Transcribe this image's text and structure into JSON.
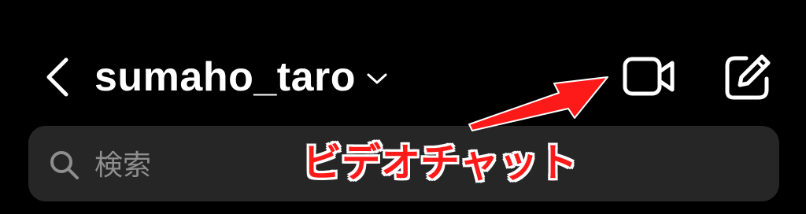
{
  "header": {
    "username": "sumaho_taro",
    "back_icon": "chevron-left-icon",
    "switch_account_icon": "chevron-down-icon",
    "video_call_icon": "video-camera-icon",
    "compose_icon": "edit-square-icon"
  },
  "search": {
    "placeholder": "検索",
    "value": "",
    "icon": "search-icon"
  },
  "annotation": {
    "label": "ビデオチャット",
    "color": "#ff1a1a",
    "outline_color": "#ffffff"
  },
  "colors": {
    "background": "#000000",
    "search_bar": "#262626",
    "placeholder": "#8e8e8e",
    "foreground": "#ffffff"
  }
}
